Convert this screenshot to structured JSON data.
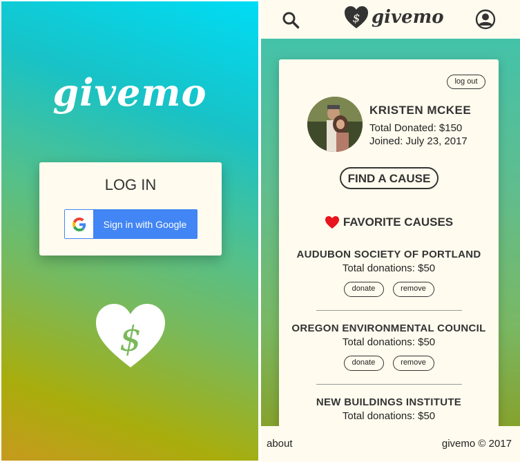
{
  "login_screen": {
    "brand": "givemo",
    "card_title": "LOG IN",
    "google_button_label": "Sign in with Google"
  },
  "profile_screen": {
    "nav": {
      "brand": "givemo"
    },
    "logout_label": "log out",
    "user": {
      "name": "KRISTEN MCKEE",
      "total_donated": "Total Donated: $150",
      "joined": "Joined: July 23, 2017"
    },
    "find_cause_label": "FIND A CAUSE",
    "favorites_title": "FAVORITE CAUSES",
    "causes": [
      {
        "name": "AUDUBON SOCIETY OF PORTLAND",
        "total": "Total donations: $50",
        "donate": "donate",
        "remove": "remove"
      },
      {
        "name": "OREGON ENVIRONMENTAL COUNCIL",
        "total": "Total donations: $50",
        "donate": "donate",
        "remove": "remove"
      },
      {
        "name": "NEW BUILDINGS INSTITUTE",
        "total": "Total donations: $50"
      }
    ],
    "footer": {
      "about": "about",
      "copyright": "givemo © 2017"
    }
  },
  "colors": {
    "cream": "#fffbee",
    "google_blue": "#4285f4",
    "heart_red": "#e8141e",
    "text_dark": "#333333",
    "gradient_top": "#00dcf5",
    "gradient_bottom": "#c79a1e"
  }
}
